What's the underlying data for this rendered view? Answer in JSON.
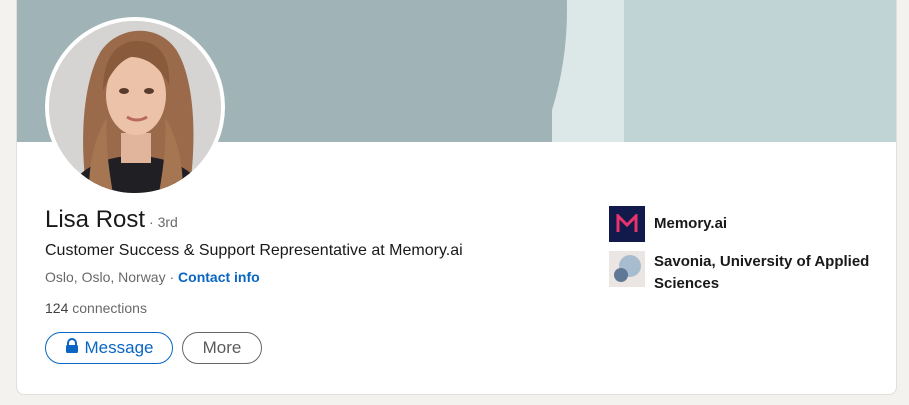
{
  "profile": {
    "name": "Lisa Rost",
    "degree": "· 3rd",
    "headline": "Customer Success & Support Representative at Memory.ai",
    "location": "Oslo, Oslo, Norway",
    "location_separator": " · ",
    "contact_info": "Contact info",
    "connections_count": "124",
    "connections_label": " connections"
  },
  "actions": {
    "message_label": "Message",
    "more_label": "More"
  },
  "sidebar": {
    "items": [
      {
        "label": "Memory.ai",
        "icon": "memory-ai-logo"
      },
      {
        "label": "Savonia, University of Applied Sciences",
        "icon": "savonia-logo"
      }
    ]
  },
  "colors": {
    "accent": "#0a66c2",
    "banner": "#a0b4b7",
    "memory_logo_bg": "#111a4a",
    "memory_logo_fg": "#e8336d"
  }
}
